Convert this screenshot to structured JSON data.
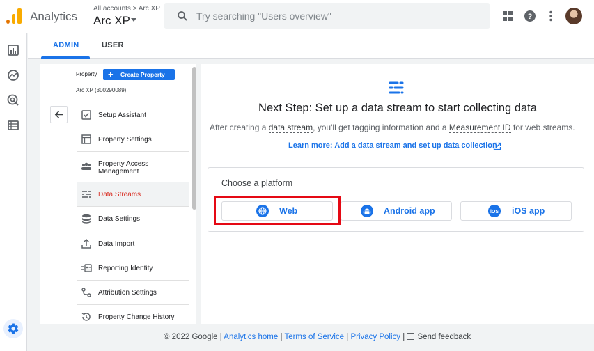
{
  "header": {
    "app_name": "Analytics",
    "breadcrumb": "All accounts > Arc XP",
    "account_name": "Arc XP",
    "search_placeholder": "Try searching \"Users overview\""
  },
  "tabs": [
    {
      "label": "ADMIN",
      "active": true
    },
    {
      "label": "USER",
      "active": false
    }
  ],
  "property_panel": {
    "property_label": "Property",
    "create_button": "Create Property",
    "property_id": "Arc XP (300290089)",
    "items": [
      {
        "label": "Setup Assistant",
        "icon": "checkbox-icon"
      },
      {
        "label": "Property Settings",
        "icon": "window-icon"
      },
      {
        "label": "Property Access Management",
        "icon": "people-icon"
      },
      {
        "label": "Data Streams",
        "icon": "data-streams-icon",
        "active": true
      },
      {
        "label": "Data Settings",
        "icon": "database-icon"
      },
      {
        "label": "Data Import",
        "icon": "upload-icon"
      },
      {
        "label": "Reporting Identity",
        "icon": "identity-icon"
      },
      {
        "label": "Attribution Settings",
        "icon": "attribution-icon"
      },
      {
        "label": "Property Change History",
        "icon": "history-icon"
      }
    ]
  },
  "main": {
    "headline": "Next Step: Set up a data stream to start collecting data",
    "sub_1": "After creating a ",
    "sub_link_1": "data stream",
    "sub_2": ", you'll get tagging information and a ",
    "sub_link_2": "Measurement ID",
    "sub_3": " for web streams.",
    "learn_more": "Learn more: Add a data stream and set up data collection",
    "choose_platform": "Choose a platform",
    "platforms": [
      {
        "label": "Web",
        "icon": "globe-icon"
      },
      {
        "label": "Android app",
        "icon": "android-icon"
      },
      {
        "label": "iOS app",
        "icon": "ios-icon"
      }
    ]
  },
  "footer": {
    "copyright": "© 2022 Google",
    "analytics_home": "Analytics home",
    "terms": "Terms of Service",
    "privacy": "Privacy Policy",
    "feedback": "Send feedback"
  },
  "colors": {
    "accent": "#1a73e8",
    "active_nav": "#d93025",
    "highlight_box": "#e50914"
  }
}
